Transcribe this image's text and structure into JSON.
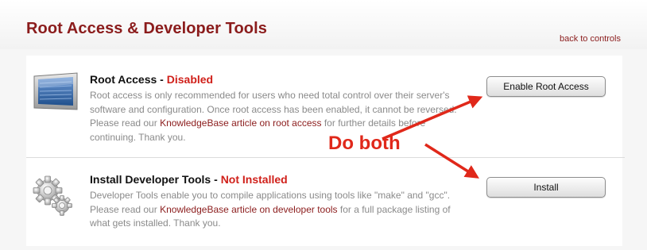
{
  "header": {
    "title": "Root Access & Developer Tools",
    "back_link": "back to controls"
  },
  "root_access": {
    "title": "Root Access",
    "separator": " - ",
    "status": "Disabled",
    "desc_line1": "Root access is only recommended for users who need total control over their server's",
    "desc_line2": "software and configuration. Once root access has been enabled, it cannot be reversed.",
    "desc_line3_pre": "Please read our ",
    "desc_link": "KnowledgeBase article on root access",
    "desc_line3_post": " for further details before",
    "desc_line4": "continuing. Thank you.",
    "button": "Enable Root Access",
    "icon": "server-panel-icon"
  },
  "dev_tools": {
    "title": "Install Developer Tools",
    "separator": " - ",
    "status": "Not Installed",
    "desc_line1": "Developer Tools enable you to compile applications using tools like \"make\" and \"gcc\".",
    "desc_line2_pre": "Please read our ",
    "desc_link": "KnowledgeBase article on developer tools",
    "desc_line2_post": " for a full package listing of",
    "desc_line3": "what gets installed. Thank you.",
    "button": "Install",
    "icon": "gears-icon"
  },
  "annotation": {
    "text": "Do both",
    "color": "#e0281a"
  },
  "colors": {
    "brand": "#8b1c1c",
    "status": "#d0201a",
    "body_text": "#8a8a8a"
  }
}
